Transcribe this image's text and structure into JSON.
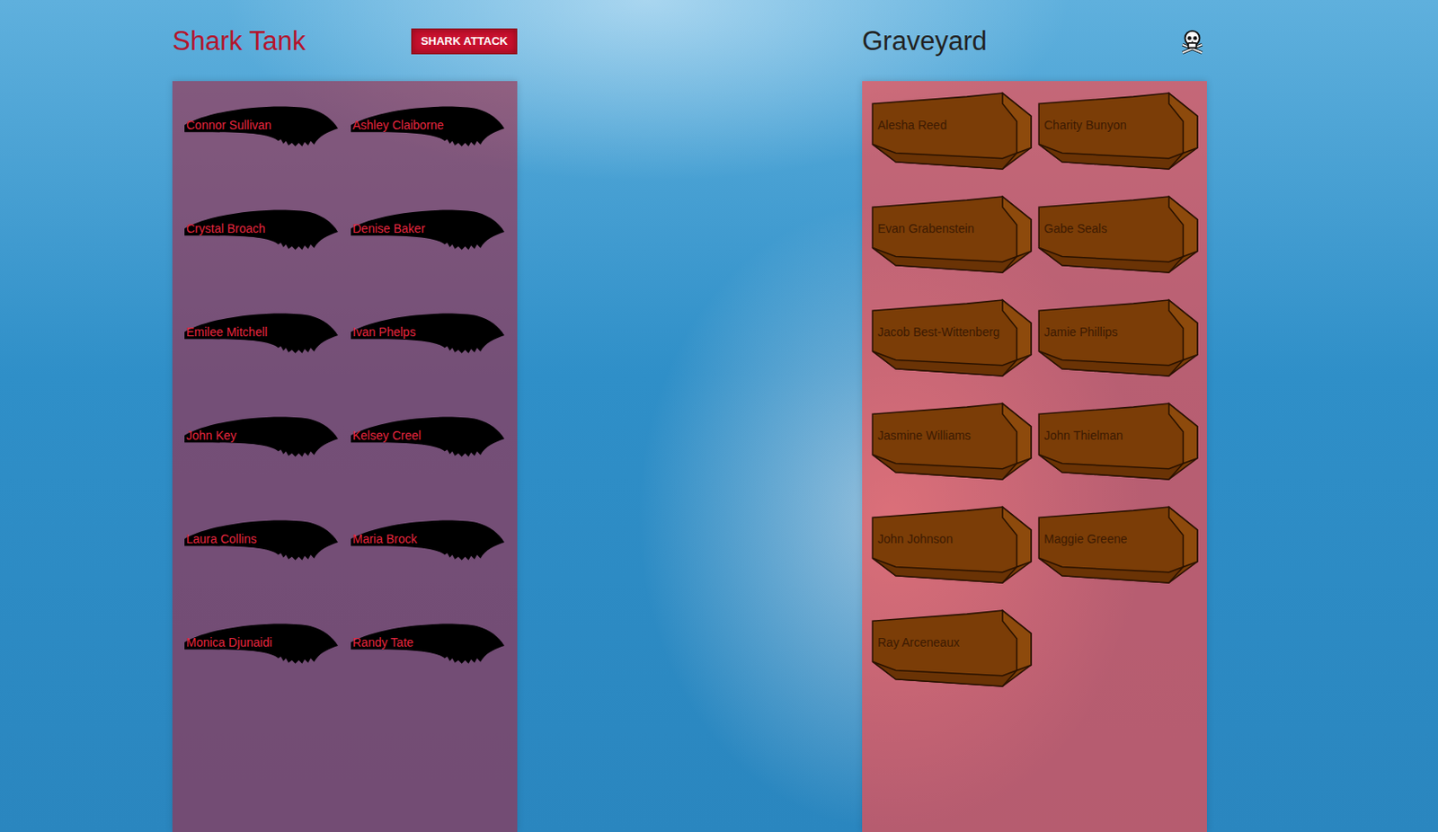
{
  "tank": {
    "title": "Shark Tank",
    "button": "SHARK ATTACK",
    "members": [
      {
        "name": "Connor Sullivan"
      },
      {
        "name": "Ashley Claiborne"
      },
      {
        "name": "Crystal Broach"
      },
      {
        "name": "Denise Baker"
      },
      {
        "name": "Emilee Mitchell"
      },
      {
        "name": "Ivan Phelps"
      },
      {
        "name": "John Key"
      },
      {
        "name": "Kelsey Creel"
      },
      {
        "name": "Laura Collins"
      },
      {
        "name": "Maria Brock"
      },
      {
        "name": "Monica Djunaidi"
      },
      {
        "name": "Randy Tate"
      }
    ]
  },
  "graveyard": {
    "title": "Graveyard",
    "members": [
      {
        "name": "Alesha Reed"
      },
      {
        "name": "Charity Bunyon"
      },
      {
        "name": "Evan Grabenstein"
      },
      {
        "name": "Gabe Seals"
      },
      {
        "name": "Jacob Best-Wittenberg"
      },
      {
        "name": "Jamie Phillips"
      },
      {
        "name": "Jasmine Williams"
      },
      {
        "name": "John Thielman"
      },
      {
        "name": "John Johnson"
      },
      {
        "name": "Maggie Greene"
      },
      {
        "name": "Ray Arceneaux"
      }
    ]
  }
}
